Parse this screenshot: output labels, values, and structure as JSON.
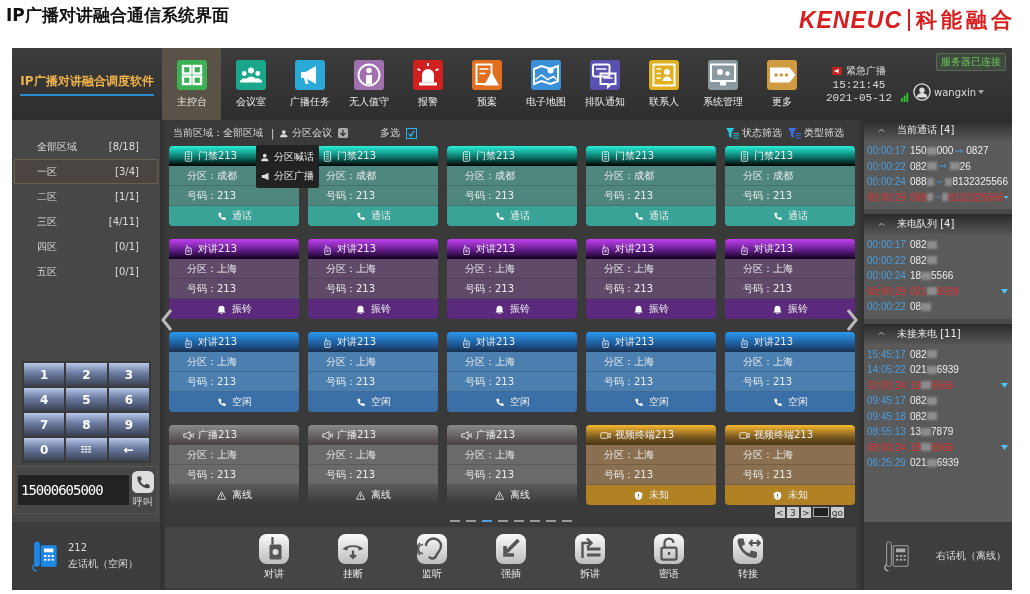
{
  "page": {
    "title": "IP广播对讲融合通信系统界面",
    "logo_latin": "KENEUC",
    "logo_cjk": "科能融合"
  },
  "app": {
    "name": "IP广播对讲融合调度软件",
    "emergency": "紧急广播",
    "time": "15:21:45",
    "date": "2021-05-12",
    "server_status": "服务器已连接",
    "user": "wangxin",
    "nav": [
      {
        "label": "主控台",
        "selected": true
      },
      {
        "label": "会议室",
        "selected": false
      },
      {
        "label": "广播任务",
        "selected": false
      },
      {
        "label": "无人值守",
        "selected": false
      },
      {
        "label": "报警",
        "selected": false
      },
      {
        "label": "预案",
        "selected": false
      },
      {
        "label": "电子地图",
        "selected": false
      },
      {
        "label": "排队通知",
        "selected": false
      },
      {
        "label": "联系人",
        "selected": false
      },
      {
        "label": "系统管理",
        "selected": false
      },
      {
        "label": "更多",
        "selected": false
      }
    ]
  },
  "zones": [
    {
      "name": "全部区域",
      "count": "[8/18]",
      "selected": false
    },
    {
      "name": "一区",
      "count": "[3/4]",
      "selected": true
    },
    {
      "name": "二区",
      "count": "[1/1]",
      "selected": false
    },
    {
      "name": "三区",
      "count": "[4/11]",
      "selected": false
    },
    {
      "name": "四区",
      "count": "[0/1]",
      "selected": false
    },
    {
      "name": "五区",
      "count": "[0/1]",
      "selected": false
    }
  ],
  "keypad": [
    {
      "kind": "digit",
      "label": "1"
    },
    {
      "kind": "digit",
      "label": "2"
    },
    {
      "kind": "digit",
      "label": "3"
    },
    {
      "kind": "digit",
      "label": "4"
    },
    {
      "kind": "digit",
      "label": "5"
    },
    {
      "kind": "digit",
      "label": "6"
    },
    {
      "kind": "digit",
      "label": "7"
    },
    {
      "kind": "digit",
      "label": "8"
    },
    {
      "kind": "digit",
      "label": "9"
    },
    {
      "kind": "digit",
      "label": "0"
    },
    {
      "kind": "grid"
    },
    {
      "kind": "digit",
      "label": "←"
    }
  ],
  "dial": {
    "number": "15000605000",
    "call": "呼叫"
  },
  "left_phone": {
    "number": "212",
    "label": "左话机（空闲）",
    "online": true
  },
  "toolbar": {
    "area": "当前区域：全部区域",
    "separator": "|",
    "meeting": "分区会议",
    "multi": "多选",
    "multi_checked": true,
    "status_filter": "状态筛选",
    "type_filter": "类型筛选"
  },
  "meeting_menu": [
    "分区喊话",
    "分区广播"
  ],
  "devices": [
    {
      "kind": "door",
      "title": "门禁213",
      "zone": "分区：成都",
      "number": "号码：213",
      "status": {
        "kind": "talking",
        "label": "通话"
      }
    },
    {
      "kind": "door",
      "title": "门禁213",
      "zone": "分区：成都",
      "number": "号码：213",
      "status": {
        "kind": "talking",
        "label": "通话"
      }
    },
    {
      "kind": "door",
      "title": "门禁213",
      "zone": "分区：成都",
      "number": "号码：213",
      "status": {
        "kind": "talking",
        "label": "通话"
      }
    },
    {
      "kind": "door",
      "title": "门禁213",
      "zone": "分区：成都",
      "number": "号码：213",
      "status": {
        "kind": "talking",
        "label": "通话"
      }
    },
    {
      "kind": "door",
      "title": "门禁213",
      "zone": "分区：成都",
      "number": "号码：213",
      "status": {
        "kind": "talking",
        "label": "通话"
      }
    },
    {
      "kind": "intercom",
      "title": "对讲213",
      "zone": "分区：上海",
      "number": "号码：213",
      "status": {
        "kind": "ringing",
        "label": "振铃"
      }
    },
    {
      "kind": "intercom",
      "title": "对讲213",
      "zone": "分区：上海",
      "number": "号码：213",
      "status": {
        "kind": "ringing",
        "label": "振铃"
      }
    },
    {
      "kind": "intercom",
      "title": "对讲213",
      "zone": "分区：上海",
      "number": "号码：213",
      "status": {
        "kind": "ringing",
        "label": "振铃"
      }
    },
    {
      "kind": "intercom",
      "title": "对讲213",
      "zone": "分区：上海",
      "number": "号码：213",
      "status": {
        "kind": "ringing",
        "label": "振铃"
      }
    },
    {
      "kind": "intercom",
      "title": "对讲213",
      "zone": "分区：上海",
      "number": "号码：213",
      "status": {
        "kind": "ringing",
        "label": "振铃"
      }
    },
    {
      "kind": "intercom",
      "title": "对讲213",
      "zone": "分区：上海",
      "number": "号码：213",
      "status": {
        "kind": "idle",
        "label": "空闲"
      }
    },
    {
      "kind": "intercom",
      "title": "对讲213",
      "zone": "分区：上海",
      "number": "号码：213",
      "status": {
        "kind": "idle",
        "label": "空闲"
      }
    },
    {
      "kind": "intercom",
      "title": "对讲213",
      "zone": "分区：上海",
      "number": "号码：213",
      "status": {
        "kind": "idle",
        "label": "空闲"
      }
    },
    {
      "kind": "intercom",
      "title": "对讲213",
      "zone": "分区：上海",
      "number": "号码：213",
      "status": {
        "kind": "idle",
        "label": "空闲"
      }
    },
    {
      "kind": "intercom",
      "title": "对讲213",
      "zone": "分区：上海",
      "number": "号码：213",
      "status": {
        "kind": "idle",
        "label": "空闲"
      }
    },
    {
      "kind": "broadcast",
      "title": "广播213",
      "zone": "分区：上海",
      "number": "号码：213",
      "status": {
        "kind": "offline",
        "label": "离线"
      }
    },
    {
      "kind": "broadcast",
      "title": "广播213",
      "zone": "分区：上海",
      "number": "号码：213",
      "status": {
        "kind": "offline",
        "label": "离线"
      }
    },
    {
      "kind": "broadcast",
      "title": "广播213",
      "zone": "分区：上海",
      "number": "号码：213",
      "status": {
        "kind": "offline",
        "label": "离线"
      }
    },
    {
      "kind": "video",
      "title": "视频终端213",
      "zone": "分区：上海",
      "number": "号码：213",
      "status": {
        "kind": "unknown",
        "label": "未知"
      }
    },
    {
      "kind": "video",
      "title": "视频终端213",
      "zone": "分区：上海",
      "number": "号码：213",
      "status": {
        "kind": "unknown",
        "label": "未知"
      }
    }
  ],
  "pager": {
    "dots": [
      {
        "selected": false
      },
      {
        "selected": false
      },
      {
        "selected": true
      },
      {
        "selected": false
      },
      {
        "selected": false
      },
      {
        "selected": false
      },
      {
        "selected": false
      },
      {
        "selected": false
      }
    ],
    "prev": "<",
    "page": "3",
    "next": ">",
    "go": "go"
  },
  "actions": [
    "对讲",
    "挂断",
    "监听",
    "强插",
    "拆讲",
    "密语",
    "转接"
  ],
  "call_sections": [
    {
      "title": "当前通话 [4]",
      "expanded": true,
      "items": [
        {
          "time": "00:00:17",
          "from": [
            {
              "kind": "digits",
              "text": "150"
            },
            {
              "kind": "masked"
            },
            {
              "kind": "digits",
              "text": "000"
            }
          ],
          "to": [
            {
              "kind": "digits",
              "text": "0827"
            }
          ],
          "alert": false
        },
        {
          "time": "00:00:22",
          "from": [
            {
              "kind": "digits",
              "text": "082"
            },
            {
              "kind": "masked"
            }
          ],
          "to": [
            {
              "kind": "masked"
            },
            {
              "kind": "digits",
              "text": "26"
            }
          ],
          "alert": false
        },
        {
          "time": "00:00:24",
          "from": [
            {
              "kind": "digits",
              "text": "088"
            },
            {
              "kind": "masked"
            }
          ],
          "to": [
            {
              "kind": "masked"
            },
            {
              "kind": "digits",
              "text": "8132325566"
            }
          ],
          "alert": false
        },
        {
          "time": "00:00:29",
          "from": [
            {
              "kind": "digits",
              "text": "088"
            },
            {
              "kind": "masked"
            }
          ],
          "to": [
            {
              "kind": "masked"
            },
            {
              "kind": "digits",
              "text": "8132325566"
            }
          ],
          "alert": true
        }
      ]
    },
    {
      "title": "来电队列 [4]",
      "expanded": true,
      "items": [
        {
          "time": "00:00:17",
          "from": [
            {
              "kind": "digits",
              "text": "082"
            },
            {
              "kind": "masked"
            }
          ],
          "alert": false
        },
        {
          "time": "00:00:22",
          "from": [
            {
              "kind": "digits",
              "text": "082"
            },
            {
              "kind": "masked"
            }
          ],
          "alert": false
        },
        {
          "time": "00:00:24",
          "from": [
            {
              "kind": "digits",
              "text": "18"
            },
            {
              "kind": "masked"
            },
            {
              "kind": "digits",
              "text": "5566"
            }
          ],
          "alert": false
        },
        {
          "time": "00:00:29",
          "from": [
            {
              "kind": "digits",
              "text": "021"
            },
            {
              "kind": "masked"
            },
            {
              "kind": "digits",
              "text": "6939"
            }
          ],
          "alert": true
        },
        {
          "time": "00:00:22",
          "from": [
            {
              "kind": "digits",
              "text": "08"
            },
            {
              "kind": "masked"
            }
          ],
          "alert": false
        }
      ]
    },
    {
      "title": "未接来电 [11]",
      "expanded": true,
      "items": [
        {
          "time": "15:45:17",
          "from": [
            {
              "kind": "digits",
              "text": "082"
            },
            {
              "kind": "masked"
            }
          ],
          "alert": false
        },
        {
          "time": "14:05:22",
          "from": [
            {
              "kind": "digits",
              "text": "021"
            },
            {
              "kind": "masked"
            },
            {
              "kind": "digits",
              "text": "6939"
            }
          ],
          "alert": false
        },
        {
          "time": "10:00:24",
          "from": [
            {
              "kind": "digits",
              "text": "18"
            },
            {
              "kind": "masked"
            },
            {
              "kind": "digits",
              "text": "5566"
            }
          ],
          "alert": true
        },
        {
          "time": "09:45:17",
          "from": [
            {
              "kind": "digits",
              "text": "082"
            },
            {
              "kind": "masked"
            }
          ],
          "alert": false
        },
        {
          "time": "09:45:18",
          "from": [
            {
              "kind": "digits",
              "text": "082"
            },
            {
              "kind": "masked"
            }
          ],
          "alert": false
        },
        {
          "time": "08:55:13",
          "from": [
            {
              "kind": "digits",
              "text": "13"
            },
            {
              "kind": "masked"
            },
            {
              "kind": "digits",
              "text": "7879"
            }
          ],
          "alert": false
        },
        {
          "time": "08:00:24",
          "from": [
            {
              "kind": "digits",
              "text": "18"
            },
            {
              "kind": "masked"
            },
            {
              "kind": "digits",
              "text": "5566"
            }
          ],
          "alert": true
        },
        {
          "time": "06:25:29",
          "from": [
            {
              "kind": "digits",
              "text": "021"
            },
            {
              "kind": "masked"
            },
            {
              "kind": "digits",
              "text": "6939"
            }
          ],
          "alert": false
        }
      ]
    }
  ],
  "right_phone": {
    "label": "右话机（离线）",
    "online": false
  }
}
